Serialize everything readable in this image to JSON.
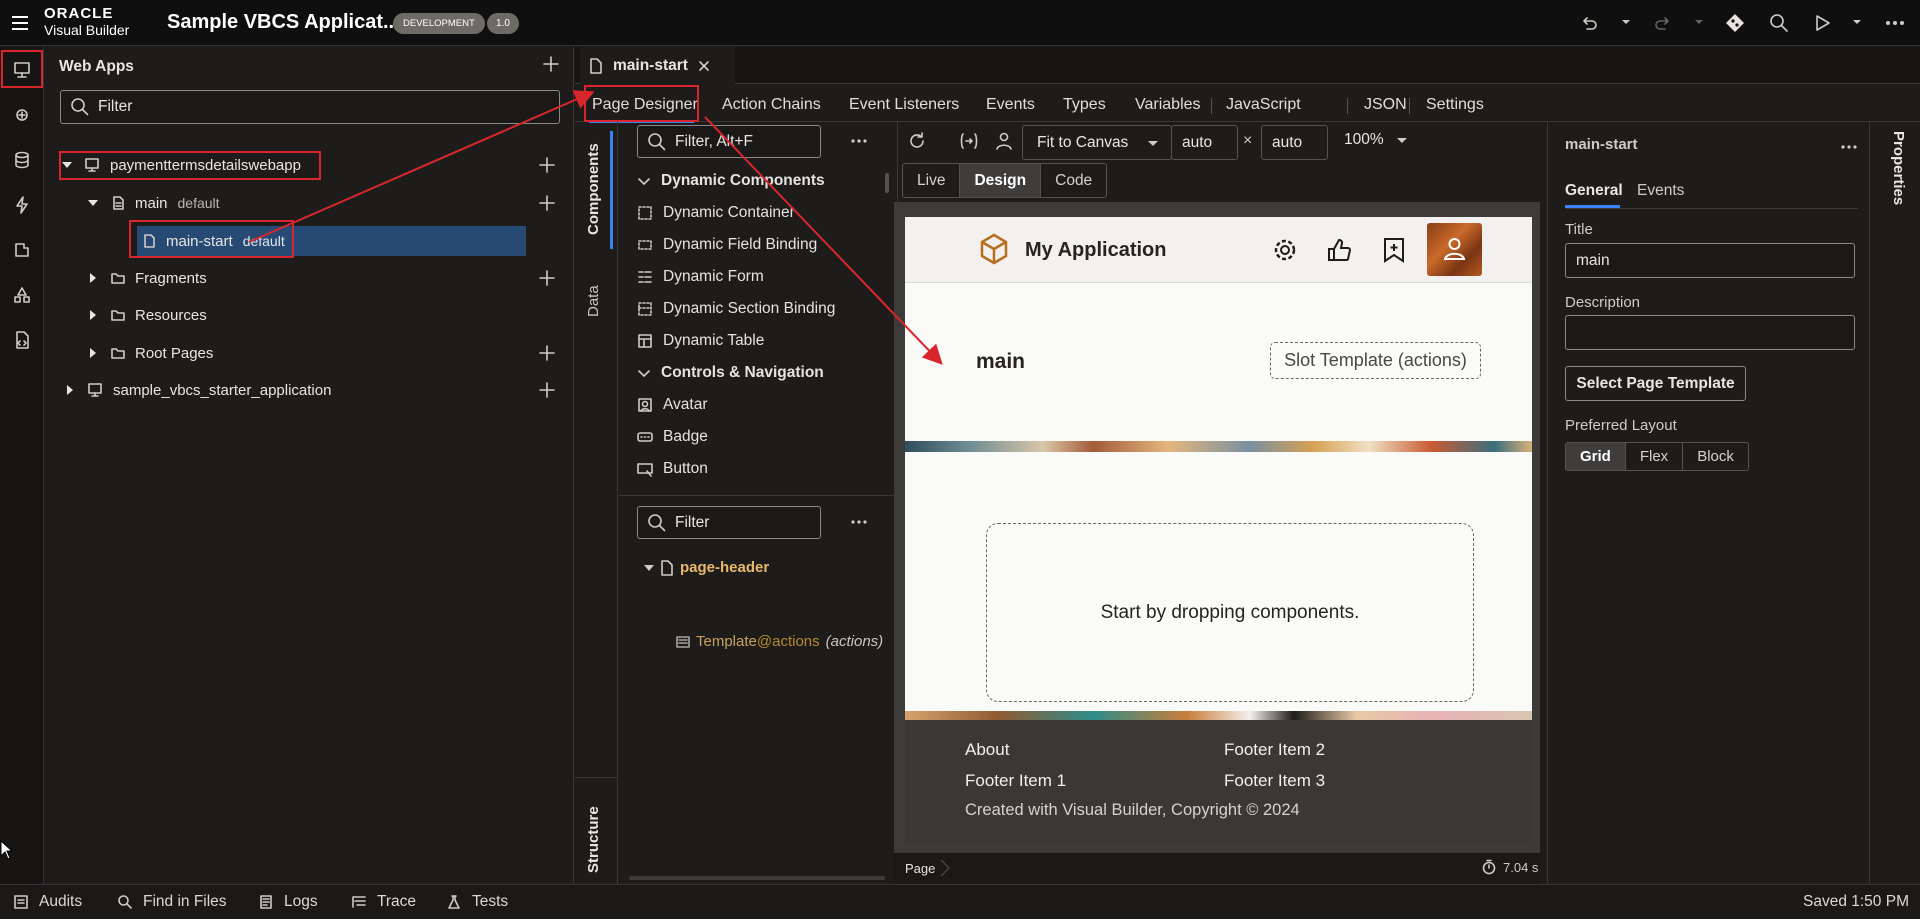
{
  "topbar": {
    "brand_line1": "ORACLE",
    "brand_line2": "Visual Builder",
    "app_title": "Sample VBCS Applicat...",
    "env_badge": "DEVELOPMENT",
    "version_badge": "1.0"
  },
  "nav": {
    "header": "Web Apps",
    "filter_placeholder": "Filter",
    "tree": [
      {
        "label": "paymenttermsdetailswebapp",
        "sub": ""
      },
      {
        "label": "main",
        "sub": "default"
      },
      {
        "label": "main-start",
        "sub": "default"
      },
      {
        "label": "Fragments",
        "sub": ""
      },
      {
        "label": "Resources",
        "sub": ""
      },
      {
        "label": "Root Pages",
        "sub": ""
      },
      {
        "label": "sample_vbcs_starter_application",
        "sub": ""
      }
    ]
  },
  "editor": {
    "file_tab": "main-start",
    "tabs": [
      "Page Designer",
      "Action Chains",
      "Event Listeners",
      "Events",
      "Types",
      "Variables",
      "JavaScript",
      "JSON",
      "Settings"
    ],
    "side_tabs": [
      "Components",
      "Data",
      "Structure"
    ],
    "palette_filter_placeholder": "Filter, Alt+F",
    "palette": [
      {
        "type": "section",
        "label": "Dynamic Components"
      },
      {
        "type": "item",
        "label": "Dynamic Container",
        "icon": "dynamic-container-icon"
      },
      {
        "type": "item",
        "label": "Dynamic Field Binding",
        "icon": "dynamic-field-icon"
      },
      {
        "type": "item",
        "label": "Dynamic Form",
        "icon": "dynamic-form-icon"
      },
      {
        "type": "item",
        "label": "Dynamic Section Binding",
        "icon": "dynamic-section-icon"
      },
      {
        "type": "item",
        "label": "Dynamic Table",
        "icon": "dynamic-table-icon"
      },
      {
        "type": "section",
        "label": "Controls & Navigation"
      },
      {
        "type": "item",
        "label": "Avatar",
        "icon": "avatar-icon"
      },
      {
        "type": "item",
        "label": "Badge",
        "icon": "badge-icon"
      },
      {
        "type": "item",
        "label": "Button",
        "icon": "button-icon"
      }
    ],
    "structure_filter_placeholder": "Filter",
    "structure": {
      "root": "page-header",
      "child_name": "Template",
      "child_slot": "@actions",
      "child_note": "(actions)"
    },
    "toolbar": {
      "fit": "Fit to Canvas",
      "width": "auto",
      "times": "×",
      "height": "auto",
      "zoom": "100%"
    },
    "modes": [
      "Live",
      "Design",
      "Code"
    ],
    "status": {
      "breadcrumb": "Page",
      "timing": "7.04 s"
    }
  },
  "canvas": {
    "app_name": "My Application",
    "page_title": "main",
    "slot_template": "Slot Template (actions)",
    "drop_hint": "Start by dropping components.",
    "footer": {
      "col1": [
        "About",
        "Footer Item 1"
      ],
      "col2": [
        "Footer Item 2",
        "Footer Item 3"
      ],
      "copyright": "Created with Visual Builder, Copyright © 2024"
    }
  },
  "properties": {
    "header": "main-start",
    "tabs": [
      "General",
      "Events"
    ],
    "title_label": "Title",
    "title_value": "main",
    "description_label": "Description",
    "description_value": "",
    "select_template_button": "Select Page Template",
    "layout_label": "Preferred Layout",
    "layout_options": [
      "Grid",
      "Flex",
      "Block"
    ],
    "side_tab": "Properties"
  },
  "bottombar": {
    "items": [
      "Audits",
      "Find in Files",
      "Logs",
      "Trace",
      "Tests"
    ],
    "saved": "Saved 1:50 PM"
  },
  "colors": {
    "accent_blue": "#3b82f6",
    "selection": "#264a73",
    "annotation_red": "#d9262d",
    "section_orange": "#e8b86a"
  }
}
